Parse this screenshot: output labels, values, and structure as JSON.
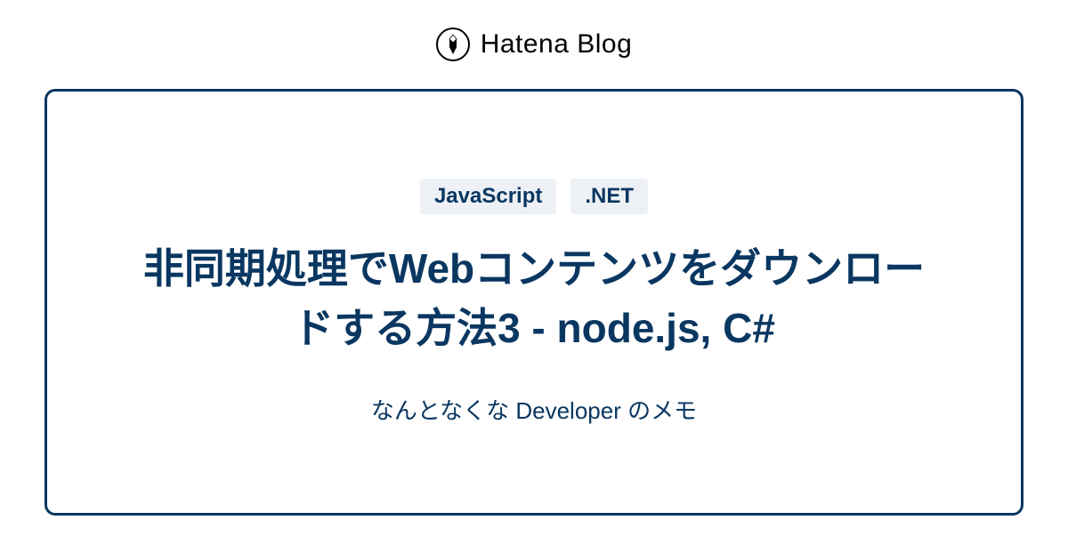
{
  "header": {
    "logo_text": "Hatena Blog"
  },
  "card": {
    "tags": [
      "JavaScript",
      ".NET"
    ],
    "title": "非同期処理でWebコンテンツをダウンロードする方法3 - node.js, C#",
    "subtitle": "なんとなくな Developer のメモ"
  }
}
